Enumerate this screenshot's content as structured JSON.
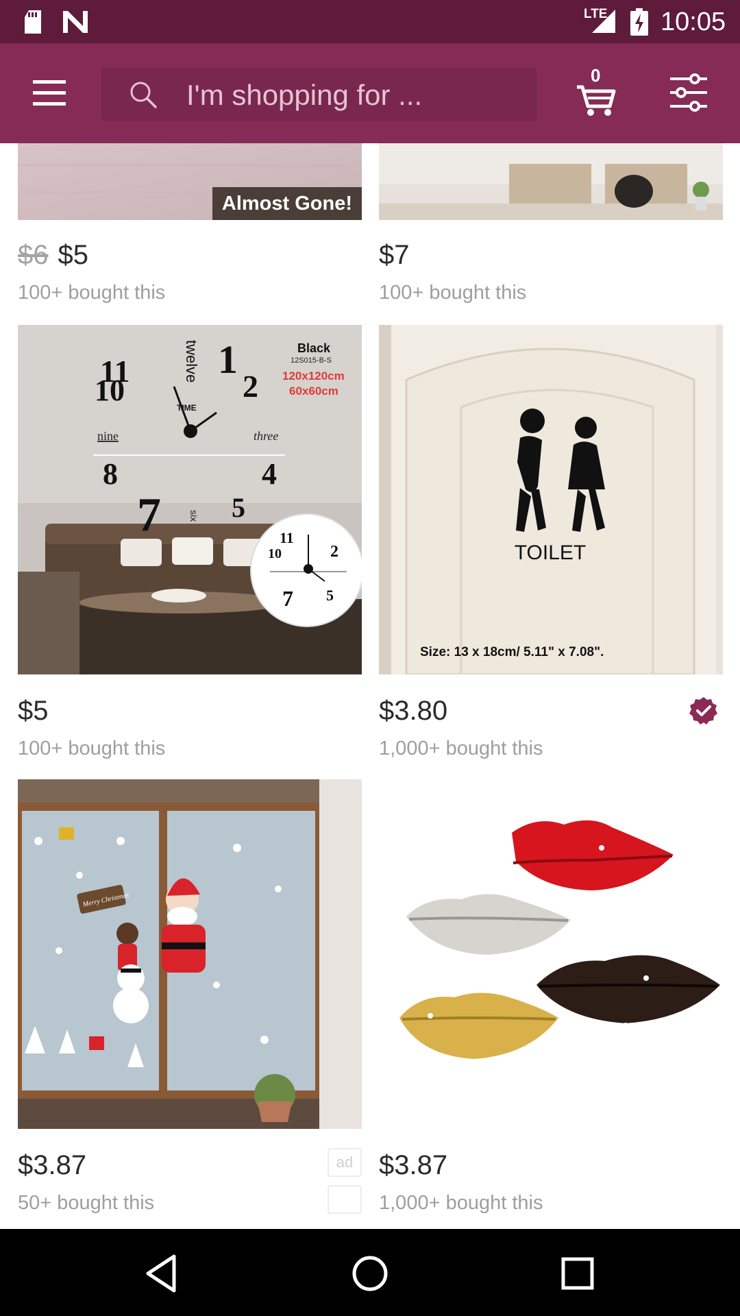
{
  "status_bar": {
    "network": "LTE",
    "time": "10:05"
  },
  "app_bar": {
    "search_placeholder": "I'm shopping for ...",
    "cart_count": "0"
  },
  "products": [
    {
      "old_price": "$6",
      "price": "$5",
      "bought": "100+ bought this",
      "badge": "Almost Gone!"
    },
    {
      "price": "$7",
      "bought": "100+ bought this"
    },
    {
      "price": "$5",
      "bought": "100+ bought this",
      "image_text": {
        "color": "Black",
        "model": "12S015-B-S",
        "size_a": "120x120cm",
        "size_b": "60x60cm",
        "n12": "twelve",
        "n1": "1",
        "n2": "2",
        "n11": "11",
        "n10": "10",
        "n9": "nine",
        "n3": "three",
        "n8": "8",
        "n4": "4",
        "n7": "7",
        "n6": "six",
        "n5": "5",
        "time": "TIME"
      }
    },
    {
      "price": "$3.80",
      "bought": "1,000+ bought this",
      "verified": true,
      "image_text": {
        "sign": "TOILET",
        "size": "Size: 13 x 18cm/ 5.11\" x 7.08\"."
      }
    },
    {
      "price": "$3.87",
      "bought": "50+ bought this",
      "ad": "ad",
      "image_text": {
        "sign": "Merry Christmas"
      }
    },
    {
      "price": "$3.87",
      "bought": "1,000+ bought this"
    }
  ],
  "colors": {
    "status_bar": "#5e1b3b",
    "app_bar": "#852b55",
    "accent": "#8a2a55"
  }
}
